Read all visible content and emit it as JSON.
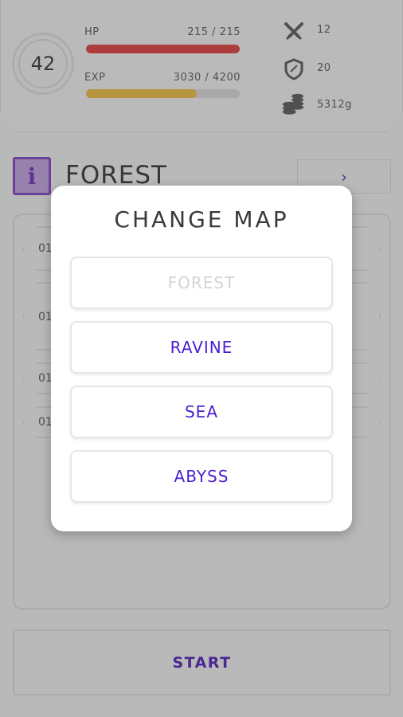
{
  "player": {
    "level": "42",
    "hp_label": "HP",
    "hp_value": "215 / 215",
    "hp_fraction": 1.0,
    "exp_label": "EXP",
    "exp_value": "3030 / 4200",
    "exp_fraction": 0.7214,
    "attack": "12",
    "defense": "20",
    "gold": "5312g"
  },
  "map_bar": {
    "current_map": "FOREST",
    "next_glyph": "›"
  },
  "list": {
    "row_labels": [
      "01",
      "01",
      "01",
      "01"
    ]
  },
  "start_label": "START",
  "modal": {
    "title": "CHANGE MAP",
    "options": [
      {
        "label": "FOREST",
        "enabled": false
      },
      {
        "label": "RAVINE",
        "enabled": true
      },
      {
        "label": "SEA",
        "enabled": true
      },
      {
        "label": "ABYSS",
        "enabled": true
      }
    ]
  },
  "colors": {
    "hp_bar": "#d63a3a",
    "exp_bar": "#e3b43c",
    "accent": "#4a1fd0"
  }
}
